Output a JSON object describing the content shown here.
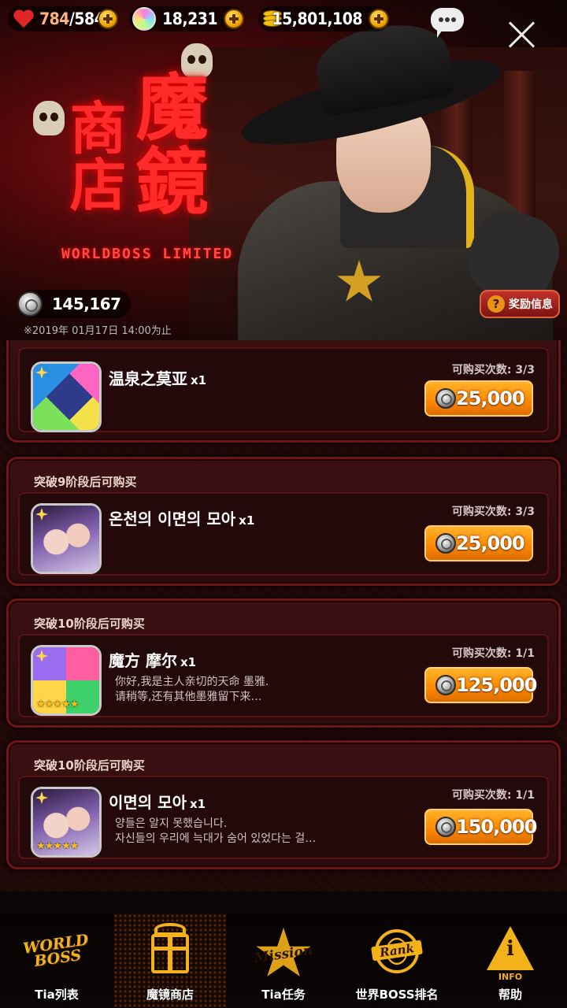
{
  "resources": {
    "stamina_current": "784",
    "stamina_max": "/584",
    "crystals": "18,231",
    "gold": "15,801,108"
  },
  "banner": {
    "title_main": "魔鏡",
    "title_sub": "商店",
    "tagline": "WORLDBOSS LIMITED",
    "currency_amount": "145,167",
    "deadline": "※2019年 01月17日 14:00为止",
    "reward_info_label": "奖励信息"
  },
  "items": [
    {
      "requirement": "",
      "name": "温泉之莫亚",
      "qty": "x1",
      "desc": [
        "",
        ""
      ],
      "limit_label": "可购买次数: 3/3",
      "price": "25,000",
      "icon": "cube-character-icon",
      "stars": ""
    },
    {
      "requirement": "突破9阶段后可购买",
      "name": "온천의 이면의 모아",
      "qty": "x1",
      "desc": [
        "",
        ""
      ],
      "limit_label": "可购买次数: 3/3",
      "price": "25,000",
      "icon": "twin-girls-portrait-icon",
      "stars": ""
    },
    {
      "requirement": "突破10阶段后可购买",
      "name": "魔方 摩尔",
      "qty": "x1",
      "desc": [
        "你好,我是主人亲切的天命 墨雅.",
        "请稍等,还有其他墨雅留下来…"
      ],
      "limit_label": "可购买次数: 1/1",
      "price": "125,000",
      "icon": "cube-stack-icon",
      "stars": "★★★★★"
    },
    {
      "requirement": "突破10阶段后可购买",
      "name": "이면의 모아",
      "qty": "x1",
      "desc": [
        "양들은 알지 못했습니다.",
        "자신들의 우리에 늑대가 숨어 있었다는 걸…"
      ],
      "limit_label": "可购买次数: 1/1",
      "price": "150,000",
      "icon": "twin-girls-portrait-icon",
      "stars": "★★★★★"
    }
  ],
  "nav": [
    {
      "label": "Tia列表",
      "emblem": "WORLD BOSS"
    },
    {
      "label": "魔镜商店",
      "emblem": "gift-icon"
    },
    {
      "label": "Tia任务",
      "emblem": "Mission"
    },
    {
      "label": "世界BOSS排名",
      "emblem": "Rank"
    },
    {
      "label": "帮助",
      "emblem": "INFO"
    }
  ],
  "colors": {
    "accent": "#ff8a00",
    "banner_red": "#ff2a2a",
    "nav_gold": "#f4b21a"
  }
}
